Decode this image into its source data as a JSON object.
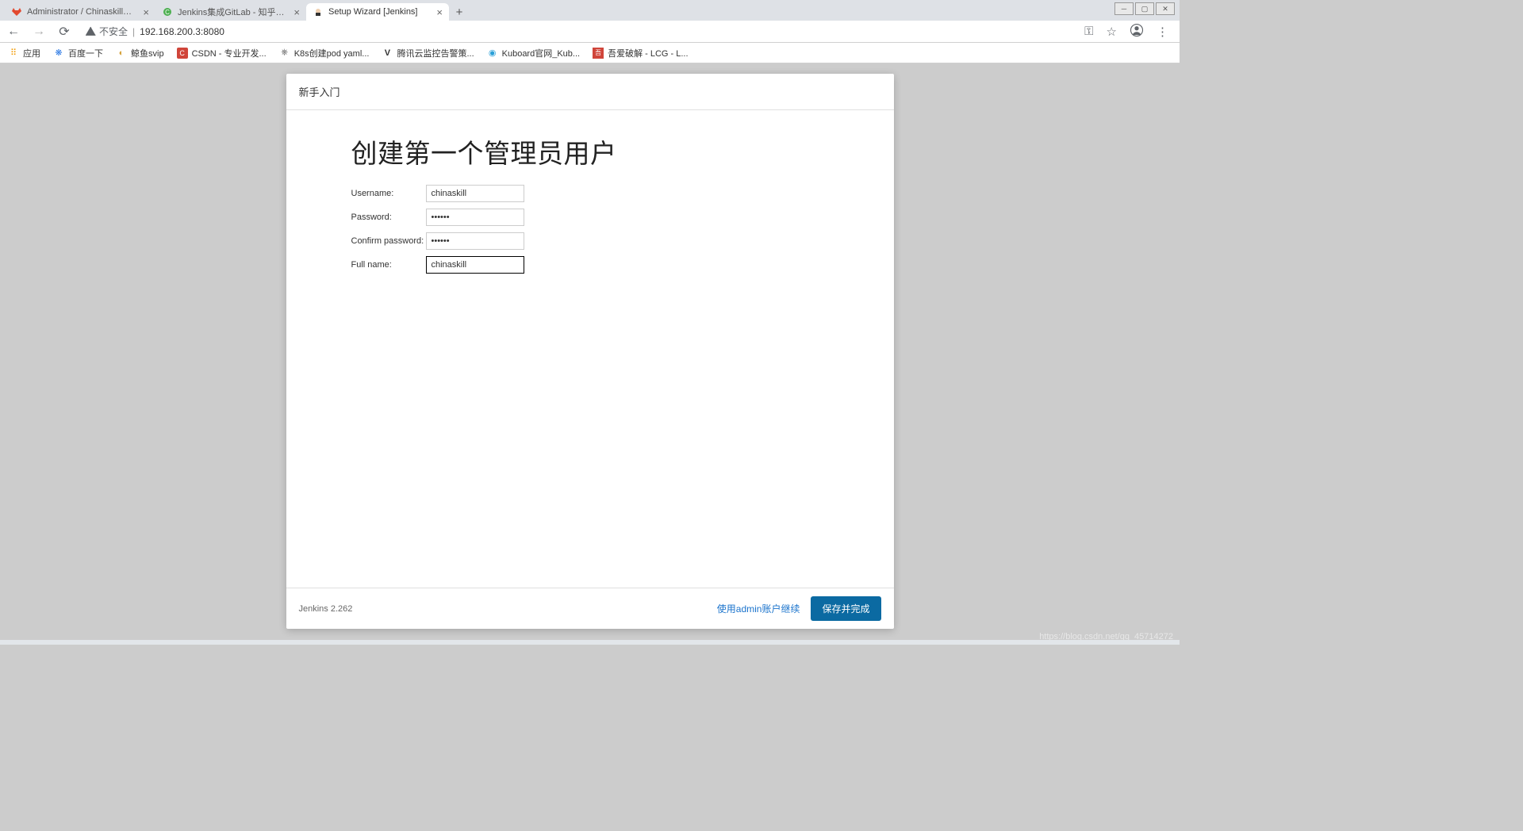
{
  "browser": {
    "tabs": [
      {
        "title": "Administrator / ChinaskillProje...",
        "favColor": "#e2492f"
      },
      {
        "title": "Jenkins集成GitLab - 知乎 - osc...",
        "favColor": "#4caf50"
      },
      {
        "title": "Setup Wizard [Jenkins]",
        "favColor": "#d33833",
        "active": true
      }
    ],
    "address": {
      "insecure_label": "不安全",
      "url": "192.168.200.3:8080"
    },
    "bookmarks": [
      {
        "label": "应用",
        "color": "#888"
      },
      {
        "label": "百度一下",
        "color": "#2a78e4"
      },
      {
        "label": "鲸鱼svip",
        "color": "#d5a13a"
      },
      {
        "label": "CSDN - 专业开发...",
        "color": "#d0453a"
      },
      {
        "label": "K8s创建pod yaml...",
        "color": "#555"
      },
      {
        "label": "腾讯云监控告警策...",
        "color": "#333"
      },
      {
        "label": "Kuboard官网_Kub...",
        "color": "#2aa0d8"
      },
      {
        "label": "吾爱破解 - LCG - L...",
        "color": "#d0453a"
      }
    ]
  },
  "wizard": {
    "header": "新手入门",
    "title": "创建第一个管理员用户",
    "fields": {
      "username": {
        "label": "Username:",
        "value": "chinaskill"
      },
      "password": {
        "label": "Password:",
        "value": "••••••"
      },
      "confirm": {
        "label": "Confirm password:",
        "value": "••••••"
      },
      "fullname": {
        "label": "Full name:",
        "value": "chinaskill"
      }
    },
    "footer": {
      "version": "Jenkins 2.262",
      "skip_label": "使用admin账户继续",
      "save_label": "保存并完成"
    }
  },
  "watermark": "https://blog.csdn.net/qq_45714272"
}
